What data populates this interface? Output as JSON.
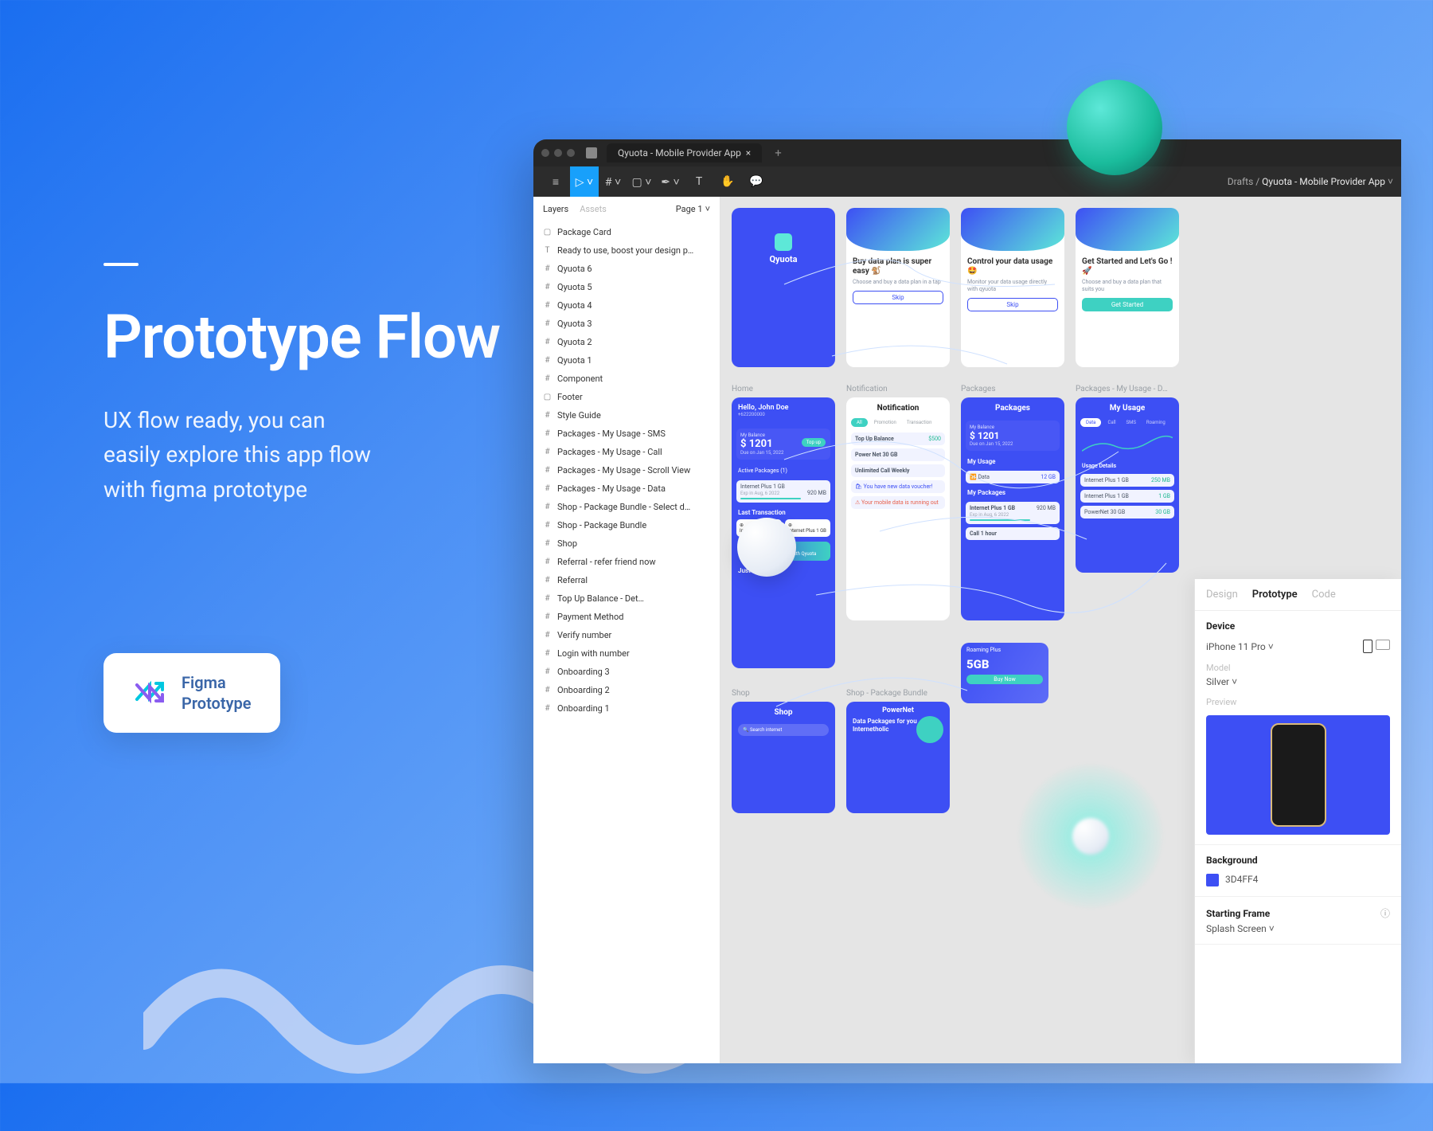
{
  "hero": {
    "title": "Prototype Flow",
    "subtitle_l1": "UX flow ready, you can",
    "subtitle_l2": "easily explore this app flow",
    "subtitle_l3": "with figma prototype"
  },
  "cta": {
    "line1": "Figma",
    "line2": "Prototype"
  },
  "figma": {
    "tab_title": "Qyuota - Mobile Provider App",
    "breadcrumb_root": "Drafts",
    "breadcrumb_current": "Qyuota - Mobile Provider App",
    "side_tabs": {
      "layers": "Layers",
      "assets": "Assets",
      "page": "Page 1"
    }
  },
  "layers": [
    {
      "icon": "▢",
      "t": "Package Card"
    },
    {
      "icon": "T",
      "t": "Ready to use, boost your design p…"
    },
    {
      "icon": "#",
      "t": "Qyuota 6"
    },
    {
      "icon": "#",
      "t": "Qyuota 5"
    },
    {
      "icon": "#",
      "t": "Qyuota 4"
    },
    {
      "icon": "#",
      "t": "Qyuota 3"
    },
    {
      "icon": "#",
      "t": "Qyuota 2"
    },
    {
      "icon": "#",
      "t": "Qyuota 1"
    },
    {
      "icon": "#",
      "t": "Component"
    },
    {
      "icon": "▢",
      "t": "Footer"
    },
    {
      "icon": "#",
      "t": "Style Guide"
    },
    {
      "icon": "#",
      "t": "Packages - My Usage - SMS"
    },
    {
      "icon": "#",
      "t": "Packages - My Usage - Call"
    },
    {
      "icon": "#",
      "t": "Packages - My Usage - Scroll View"
    },
    {
      "icon": "#",
      "t": "Packages - My Usage - Data"
    },
    {
      "icon": "#",
      "t": "Shop - Package Bundle - Select d…"
    },
    {
      "icon": "#",
      "t": "Shop - Package Bundle"
    },
    {
      "icon": "#",
      "t": "Shop"
    },
    {
      "icon": "#",
      "t": "Referral - refer friend now"
    },
    {
      "icon": "#",
      "t": "Referral"
    },
    {
      "icon": "#",
      "t": "Top Up Balance - Det…"
    },
    {
      "icon": "#",
      "t": "Payment Method"
    },
    {
      "icon": "#",
      "t": "Verify number"
    },
    {
      "icon": "#",
      "t": "Login with number"
    },
    {
      "icon": "#",
      "t": "Onboarding 3"
    },
    {
      "icon": "#",
      "t": "Onboarding 2"
    },
    {
      "icon": "#",
      "t": "Onboarding 1"
    }
  ],
  "canvas": {
    "row1": {
      "logo": "Qyuota",
      "card2_h": "Buy data plan is super easy 🐒",
      "card2_b": "Skip",
      "card3_h": "Control your data usage 🤩",
      "card3_b": "Skip",
      "card4_h": "Get Started and Let's Go ! 🚀",
      "card4_b": "Get Started"
    },
    "labels": {
      "home": "Home",
      "notif": "Notification",
      "pkg": "Packages",
      "pkg_u": "Packages - My Usage - D…",
      "shop": "Shop",
      "shop_b": "Shop - Package Bundle"
    },
    "home": {
      "hello": "Hello, John Doe",
      "bal_l": "My Balance",
      "bal_v": "$ 1201",
      "bal_d": "Due on Jan 15, 2022",
      "ap": "Active Packages (1)",
      "lt": "Last Transaction",
      "promo": "Call and SMS Unlimited with Qyuota",
      "jfy": "Just For You"
    },
    "notif": {
      "title": "Notification",
      "tab_all": "All",
      "tab_p": "Promotion",
      "tab_t": "Transaction",
      "n1": "Top Up Balance",
      "n1v": "$500",
      "n2": "Power Net 30 GB",
      "n3": "Unlimited Call Weekly",
      "n4": "You have new data voucher!",
      "n5": "Your mobile data is running out"
    },
    "pkg": {
      "title": "Packages",
      "bal_v": "$ 1201",
      "bal_d": "Due on Jan 15, 2022",
      "mu": "My Usage",
      "u1": "Data",
      "u1v": "12 GB",
      "mp": "My Packages",
      "p1": "Internet Plus 1 GB",
      "p1s": "Exp in Aug, 6 2022",
      "p1v": "920 MB",
      "p2": "Call 1 hour"
    },
    "usage": {
      "title": "My Usage",
      "tab_d": "Data",
      "ud": "Usage Details",
      "r1": "Internet Plus 1 GB",
      "r1v": "250 MB",
      "r2": "Internet Plus 1 GB",
      "r2v": "1 GB",
      "r3": "PowerNet 30 GB",
      "r3v": "30 GB"
    },
    "shop": {
      "title": "Shop"
    },
    "shop_b": {
      "brand": "PowerNet",
      "h": "Data Packages for you Internetholic",
      "gb": "5GB",
      "plan": "Roaming Plus",
      "buy": "Buy Now"
    }
  },
  "rp": {
    "tabs": {
      "design": "Design",
      "proto": "Prototype",
      "code": "Code"
    },
    "device_h": "Device",
    "device_v": "iPhone 11 Pro",
    "model_h": "Model",
    "model_v": "Silver",
    "preview_h": "Preview",
    "bg_h": "Background",
    "bg_v": "3D4FF4",
    "start_h": "Starting Frame",
    "start_v": "Splash Screen"
  }
}
